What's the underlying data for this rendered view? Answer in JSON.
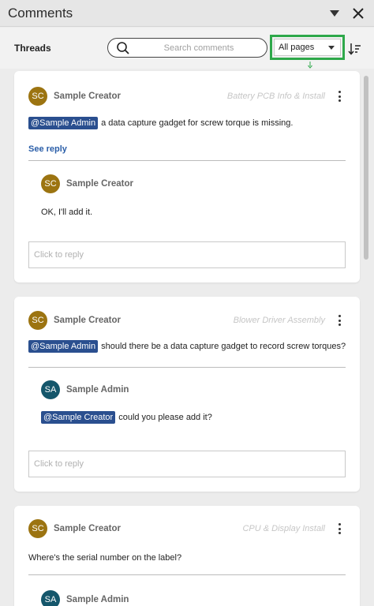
{
  "panel": {
    "title": "Comments",
    "collapse_icon": "triangle-down-icon",
    "close_icon": "close-icon"
  },
  "toolbar": {
    "threads_label": "Threads",
    "search_placeholder": "Search comments",
    "pages_selected": "All pages",
    "sort_icon": "sort-icon",
    "highlight_color": "#2ea84a"
  },
  "colors": {
    "mention_bg": "#2a4f8f",
    "creator_avatar": "#9c7411",
    "admin_avatar": "#14566b",
    "link": "#2a5ea8"
  },
  "threads": [
    {
      "author_initials": "SC",
      "author": "Sample Creator",
      "page": "Battery PCB Info & Install",
      "mention": "@Sample Admin",
      "text": "a data capture gadget for screw torque is missing.",
      "see_reply": "See reply",
      "replies": [
        {
          "author_initials": "SC",
          "author": "Sample Creator",
          "mention": "",
          "text": "OK, I'll add it."
        }
      ],
      "reply_placeholder": "Click to reply"
    },
    {
      "author_initials": "SC",
      "author": "Sample Creator",
      "page": "Blower Driver Assembly",
      "mention": "@Sample Admin",
      "text": "should there be a data capture gadget to record screw torques?",
      "replies": [
        {
          "author_initials": "SA",
          "author": "Sample Admin",
          "mention": "@Sample Creator",
          "text": "could you please add it?"
        }
      ],
      "reply_placeholder": "Click to reply"
    },
    {
      "author_initials": "SC",
      "author": "Sample Creator",
      "page": "CPU & Display Install",
      "mention": "",
      "text": "Where's the serial number on the label?",
      "replies": [
        {
          "author_initials": "SA",
          "author": "Sample Admin",
          "mention": "",
          "text": ""
        }
      ]
    }
  ]
}
